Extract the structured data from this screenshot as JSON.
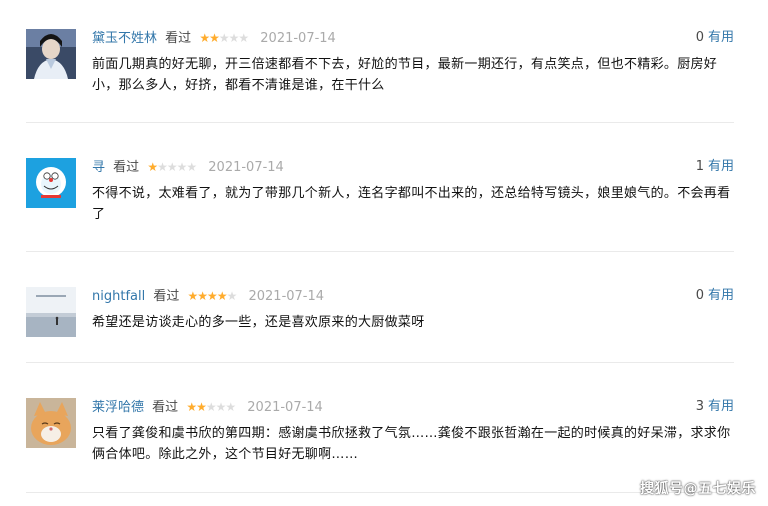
{
  "comments": [
    {
      "author": "黛玉不姓林",
      "status": "看过",
      "rating": 2,
      "date": "2021-07-14",
      "votes": "0",
      "useful_label": "有用",
      "text": "前面几期真的好无聊，开三倍速都看不下去，好尬的节目，最新一期还行，有点笑点，但也不精彩。厨房好小，那么多人，好挤，都看不清谁是谁，在干什么"
    },
    {
      "author": "寻",
      "status": "看过",
      "rating": 1,
      "date": "2021-07-14",
      "votes": "1",
      "useful_label": "有用",
      "text": "不得不说，太难看了，就为了带那几个新人，连名字都叫不出来的，还总给特写镜头，娘里娘气的。不会再看了"
    },
    {
      "author": "nightfall",
      "status": "看过",
      "rating": 4,
      "date": "2021-07-14",
      "votes": "0",
      "useful_label": "有用",
      "text": "希望还是访谈走心的多一些，还是喜欢原来的大厨做菜呀"
    },
    {
      "author": "莱浮哈德",
      "status": "看过",
      "rating": 2,
      "date": "2021-07-14",
      "votes": "3",
      "useful_label": "有用",
      "text": "只看了龚俊和虞书欣的第四期：感谢虞书欣拯救了气氛……龚俊不跟张哲瀚在一起的时候真的好呆滞，求求你俩合体吧。除此之外，这个节目好无聊啊……"
    }
  ],
  "watermark": "搜狐号@五七娱乐",
  "colors": {
    "link": "#3377aa",
    "star_on": "#ffac2d",
    "star_off": "#dddddd",
    "date": "#aaaaaa"
  }
}
